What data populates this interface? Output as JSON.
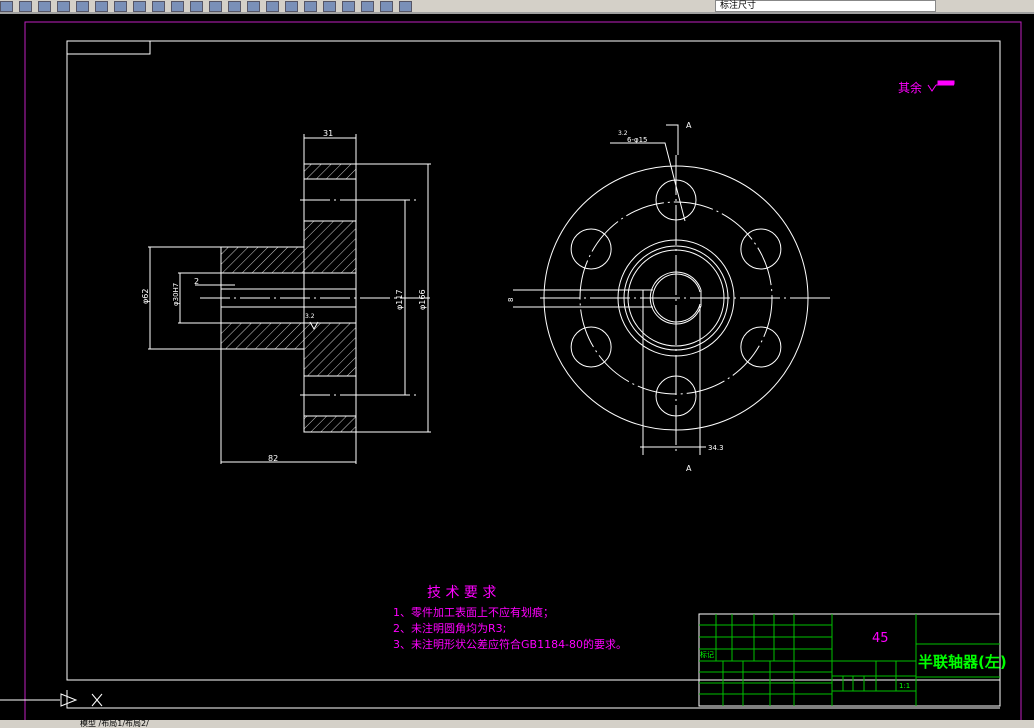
{
  "toolbar": {
    "layer_value": "标注尺寸",
    "icons": [
      "save-icon",
      "print-icon",
      "preview-icon",
      "publish-icon",
      "cut-icon",
      "copy-icon",
      "paste-icon",
      "match-icon",
      "undo-icon",
      "redo-icon",
      "pan-icon",
      "zoom-realtime-icon",
      "zoom-window-icon",
      "zoom-previous-icon",
      "properties-icon",
      "design-center-icon",
      "tool-palette-icon",
      "sheet-set-icon",
      "markup-icon",
      "calculator-icon",
      "help-icon",
      "layer-manager-icon"
    ]
  },
  "status": {
    "model_tab": "模型",
    "layout_tabs": "/布局1/布局2/"
  },
  "drawing": {
    "surface_note": "其余",
    "dims_left": {
      "width_top": "31",
      "width_bottom": "82",
      "d_bolt": "φ117",
      "d_outer": "φ166",
      "d_hub": "φ62",
      "d_bore": "φ30H7",
      "offset": "2",
      "roughness": "3.2"
    },
    "dims_right": {
      "roughness": "3.2",
      "holes": "6-φ15",
      "key_width": "8",
      "key_depth": "34.3",
      "section_top": "A",
      "section_bottom": "A"
    },
    "requirements": {
      "title": "技 术 要 求",
      "items": [
        "1、零件加工表面上不应有划痕；",
        "2、未注明圆角均为R3;",
        "3、未注明形状公差应符合GB1184-80的要求。"
      ]
    },
    "title_block": {
      "material": "45",
      "part_name": "半联轴器(左)",
      "scale": "1:1",
      "mark_label": "标记"
    }
  },
  "colors": {
    "line": "#ffffff",
    "magenta": "#ff00ff",
    "green": "#00ff00",
    "frame_magenta": "#c020c0"
  }
}
